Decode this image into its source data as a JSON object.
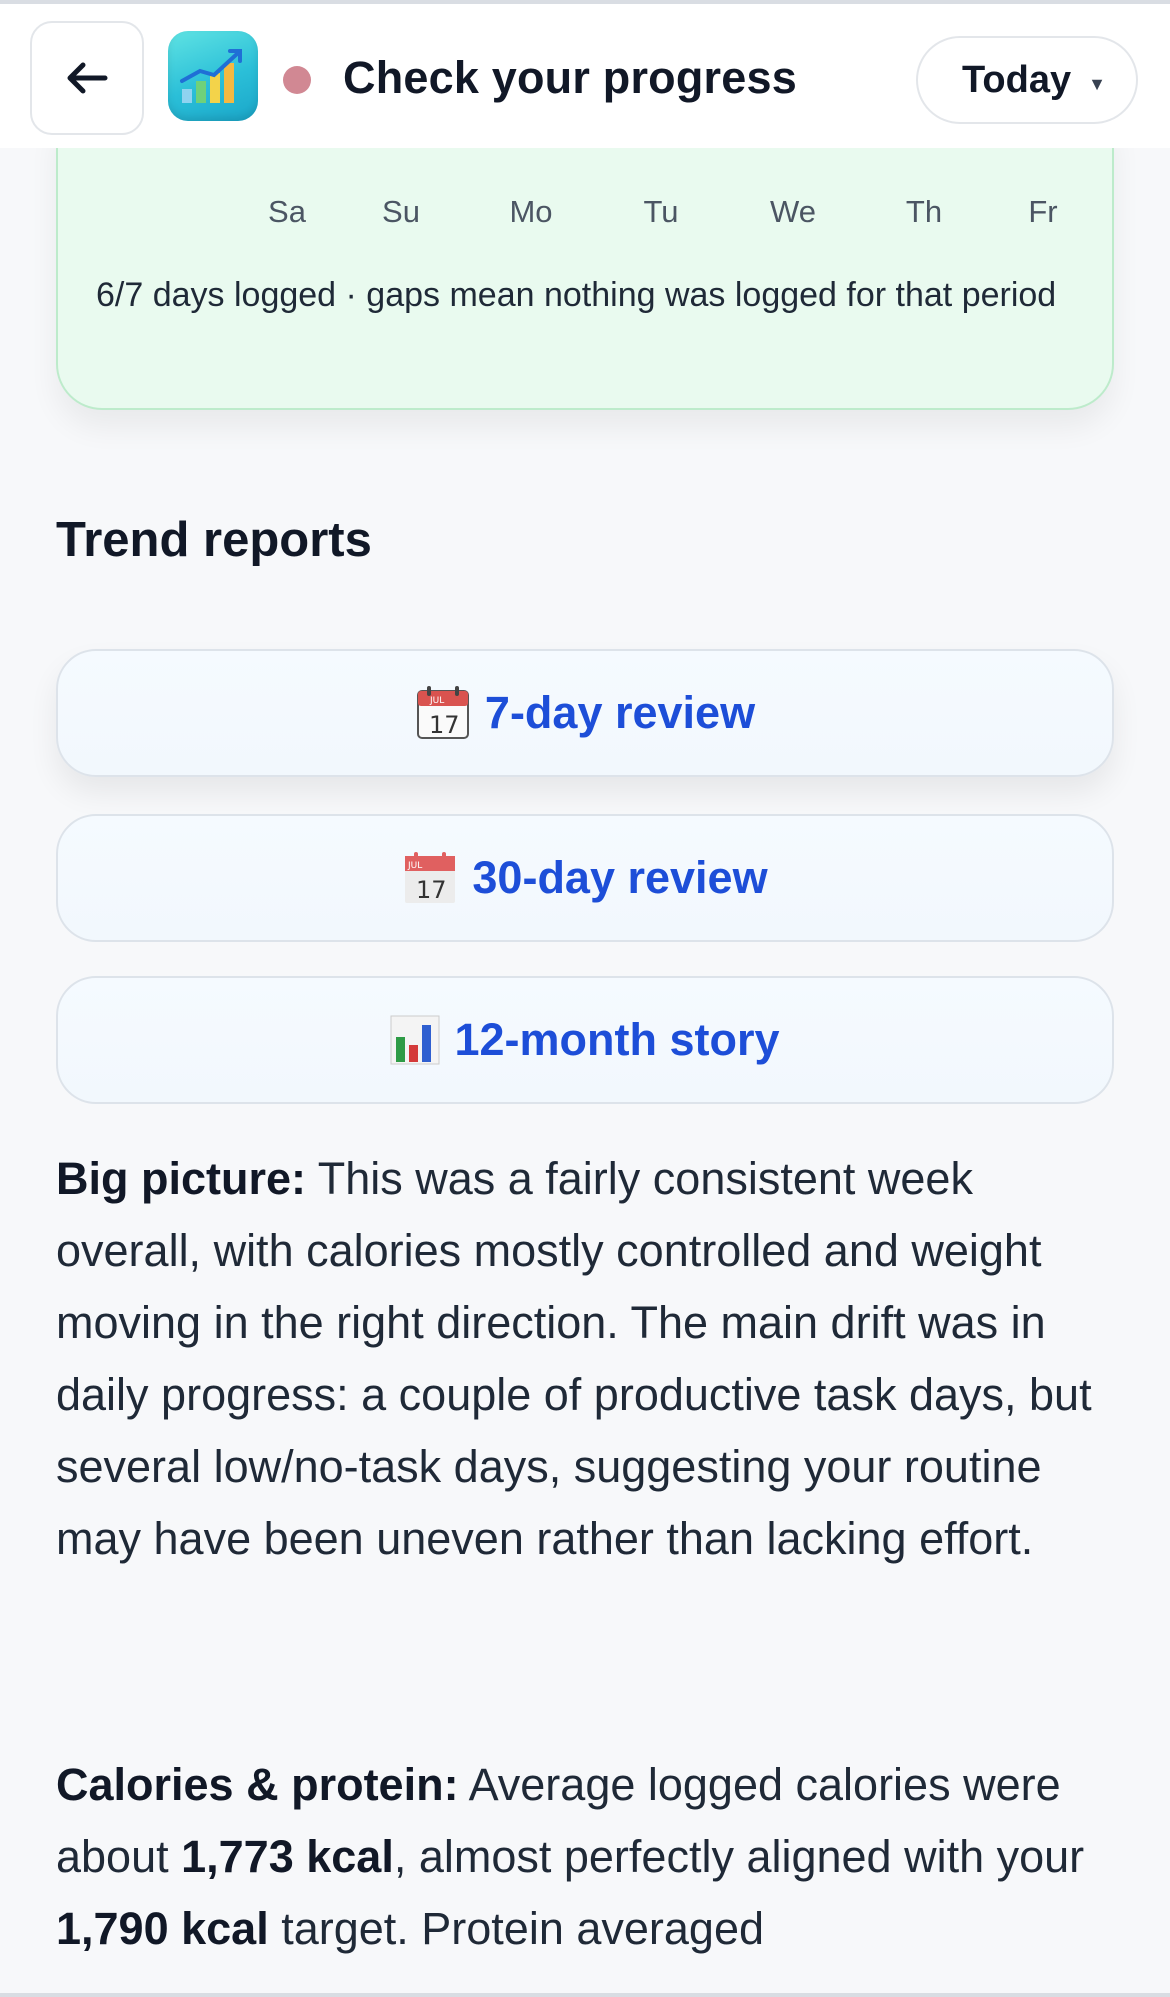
{
  "header": {
    "back_icon": "arrow-left-icon",
    "app_icon": "progress-chart-app-icon",
    "status_color": "#d18893",
    "title": "Check your progress",
    "range_selector": {
      "selected": "Today",
      "chevron_icon": "caret-down-icon"
    }
  },
  "calendar": {
    "weekdays": [
      "Sa",
      "Su",
      "Mo",
      "Tu",
      "We",
      "Th",
      "Fr"
    ],
    "note": "6/7 days logged · gaps mean nothing was logged for that period"
  },
  "trend_reports": {
    "title": "Trend reports",
    "buttons": [
      {
        "label": "7-day review",
        "icon": "calendar-icon"
      },
      {
        "label": "30-day review",
        "icon": "calendar-icon"
      },
      {
        "label": "12-month story",
        "icon": "bar-chart-icon"
      }
    ]
  },
  "summary": {
    "big_picture": {
      "heading": "Big picture:",
      "text": " This was a fairly consistent week overall, with calories mostly controlled and weight moving in the right direction. The main drift was in daily progress: a couple of productive task days, but several low/no-task days, suggesting your routine may have been uneven rather than lacking effort."
    },
    "calories": {
      "heading": "Calories & protein:",
      "t1": " Average logged calories were about ",
      "avg_kcal": "1,773 kcal",
      "t2": ", almost perfectly aligned with your ",
      "target_kcal": "1,790 kcal",
      "t3": " target. Protein averaged"
    }
  },
  "colors": {
    "accent": "#1d4ed8",
    "card_green": "#e9faef",
    "card_green_border": "#bdebcb"
  }
}
